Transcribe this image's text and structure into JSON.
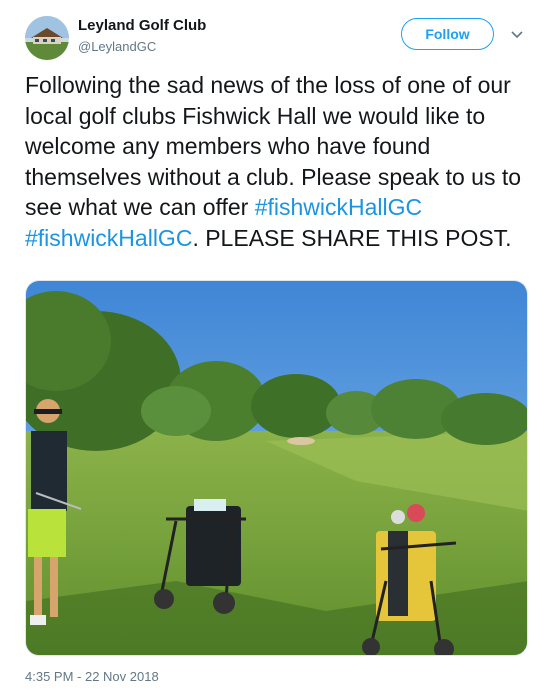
{
  "account": {
    "display_name": "Leyland Golf Club",
    "handle": "@LeylandGC"
  },
  "actions": {
    "follow_label": "Follow",
    "more_icon": "chevron-down-icon"
  },
  "tweet": {
    "text_before": "Following the sad news of the loss of one of our local golf clubs Fishwick Hall we would like to welcome any members who have found themselves without a club. Please speak to us to see what we can offer",
    "hashtags": [
      "#fishwickHallGC",
      "#fishwickHallGC"
    ],
    "text_after": ". PLEASE SHARE THIS POST.",
    "timestamp": "4:35 PM - 22 Nov 2018"
  },
  "colors": {
    "accent": "#1da1f2",
    "hashtag": "#1b95e0",
    "secondary_text": "#657786"
  }
}
